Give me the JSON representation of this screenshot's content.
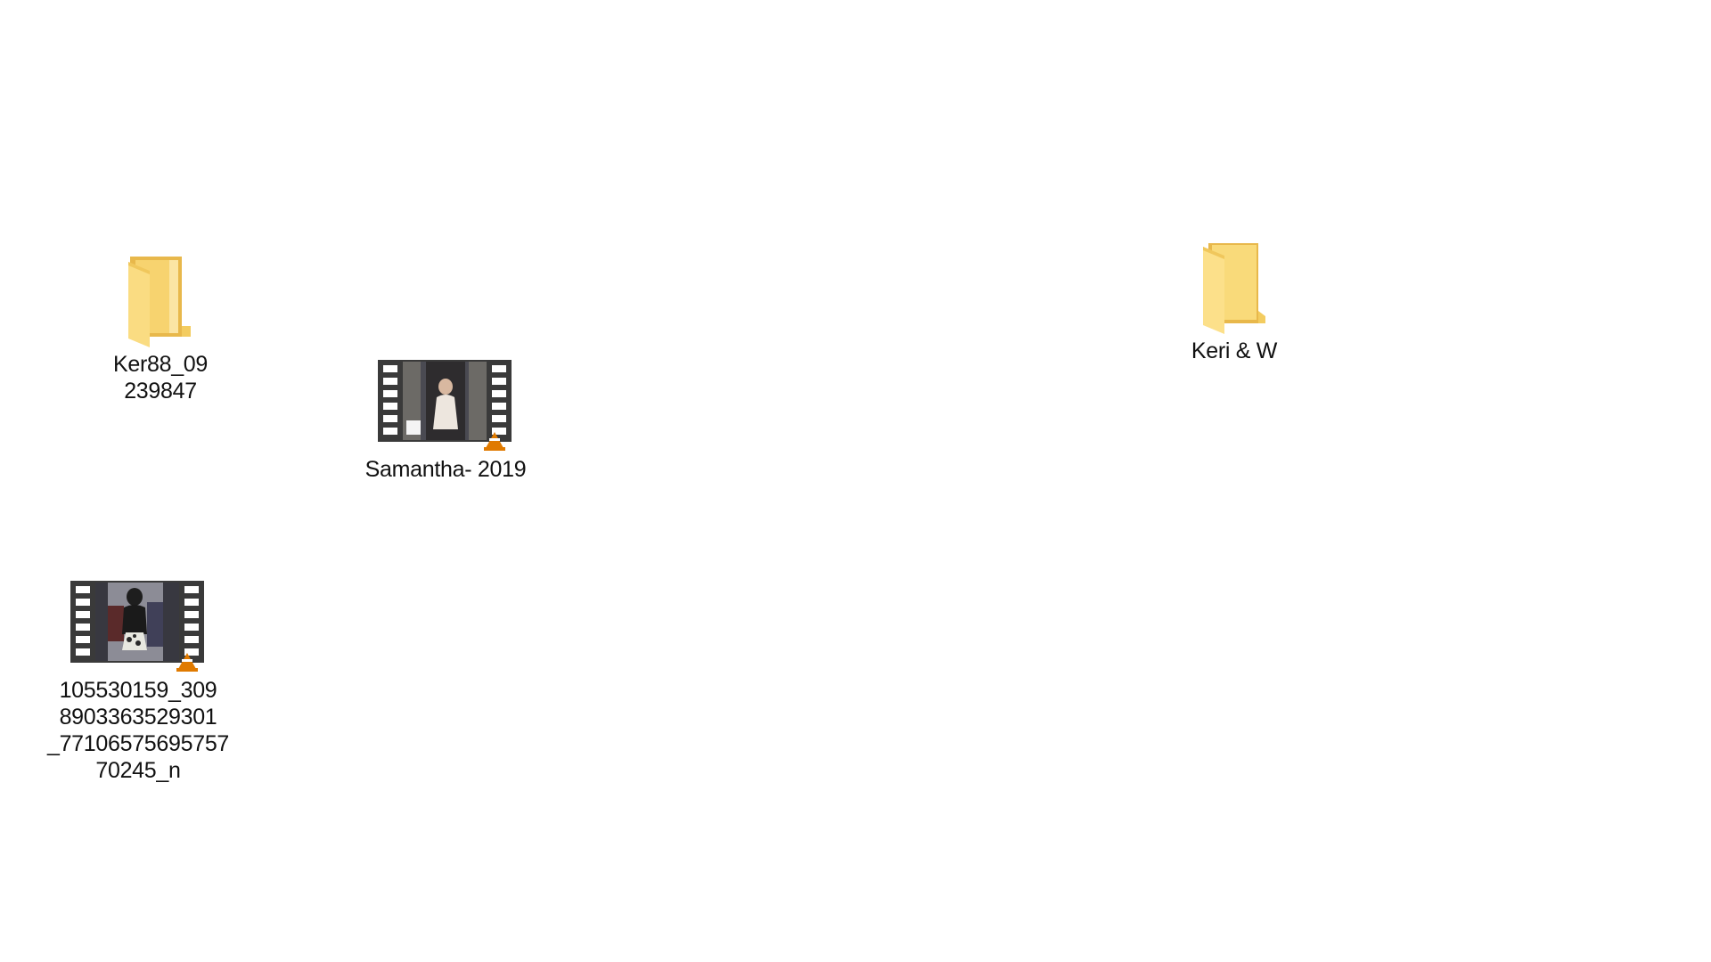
{
  "desktop": {
    "items": [
      {
        "type": "folder",
        "icon": "folder-open-icon",
        "label_lines": [
          "Ker88_09",
          "239847"
        ]
      },
      {
        "type": "video",
        "icon": "video-file-icon",
        "badge_icon": "vlc-cone-icon",
        "label_lines": [
          "Samantha- 2019"
        ]
      },
      {
        "type": "folder",
        "icon": "folder-icon",
        "label_lines": [
          "Keri & W"
        ]
      },
      {
        "type": "video",
        "icon": "video-file-icon",
        "badge_icon": "vlc-cone-icon",
        "label_lines": [
          "105530159_309",
          "8903363529301",
          "_77106575695757",
          "70245_n"
        ]
      }
    ],
    "colors": {
      "folder_back": "#E8B84B",
      "folder_front": "#FCE08A",
      "film_frame": "#3A3A3A",
      "vlc_orange": "#E07A00"
    }
  }
}
